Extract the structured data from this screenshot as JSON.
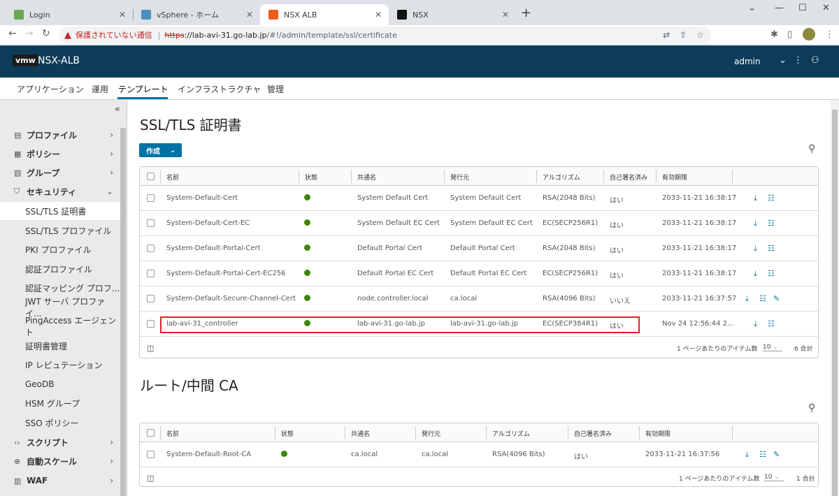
{
  "browser": {
    "tabs": [
      {
        "label": "Login",
        "active": false
      },
      {
        "label": "vSphere - ホーム",
        "active": false
      },
      {
        "label": "NSX ALB",
        "active": true
      },
      {
        "label": "NSX",
        "active": false
      }
    ],
    "address": {
      "insecure_label": "保護されていない通信",
      "scheme": "https",
      "host": "://lab-avi-31.go-lab.jp",
      "path": "/#!/admin/template/ssl/certificate"
    }
  },
  "app": {
    "logo": "vmw",
    "title": "NSX-ALB",
    "user": "admin"
  },
  "mainnav": [
    "アプリケーション",
    "運用",
    "テンプレート",
    "インフラストラクチャ",
    "管理"
  ],
  "sidebar": {
    "items": [
      {
        "label": "プロファイル",
        "type": "group"
      },
      {
        "label": "ポリシー",
        "type": "group"
      },
      {
        "label": "グループ",
        "type": "group"
      },
      {
        "label": "セキュリティ",
        "type": "group"
      },
      {
        "label": "SSL/TLS 証明書",
        "type": "sub"
      },
      {
        "label": "SSL/TLS プロファイル",
        "type": "sub"
      },
      {
        "label": "PKI プロファイル",
        "type": "sub"
      },
      {
        "label": "認証プロファイル",
        "type": "sub"
      },
      {
        "label": "認証マッピング プロフ...",
        "type": "sub"
      },
      {
        "label": "JWT サーバ プロファイ...",
        "type": "sub"
      },
      {
        "label": "PingAccess エージェント",
        "type": "sub"
      },
      {
        "label": "証明書管理",
        "type": "sub"
      },
      {
        "label": "IP レピュテーション",
        "type": "sub"
      },
      {
        "label": "GeoDB",
        "type": "sub"
      },
      {
        "label": "HSM グループ",
        "type": "sub"
      },
      {
        "label": "SSO ポリシー",
        "type": "sub"
      },
      {
        "label": "スクリプト",
        "type": "group"
      },
      {
        "label": "自動スケール",
        "type": "group"
      },
      {
        "label": "WAF",
        "type": "group"
      }
    ]
  },
  "certs": {
    "title": "SSL/TLS 証明書",
    "create_label": "作成",
    "columns": [
      "名前",
      "状態",
      "共通名",
      "発行元",
      "アルゴリズム",
      "自己署名済み",
      "有効期限"
    ],
    "rows": [
      [
        "System-Default-Cert",
        "System Default Cert",
        "System Default Cert",
        "RSA(2048 Bits)",
        "はい",
        "2033-11-21 16:38:17"
      ],
      [
        "System-Default-Cert-EC",
        "System Default EC Cert",
        "System Default EC Cert",
        "EC(SECP256R1)",
        "はい",
        "2033-11-21 16:38:17"
      ],
      [
        "System-Default-Portal-Cert",
        "Default Portal Cert",
        "Default Portal Cert",
        "RSA(2048 Bits)",
        "はい",
        "2033-11-21 16:38:17"
      ],
      [
        "System-Default-Portal-Cert-EC256",
        "Default Portal EC Cert",
        "Default Portal EC Cert",
        "EC(SECP256R1)",
        "はい",
        "2033-11-21 16:38:17"
      ],
      [
        "System-Default-Secure-Channel-Cert",
        "node.controller.local",
        "ca.local",
        "RSA(4096 Bits)",
        "いいえ",
        "2033-11-21 16:37:57"
      ],
      [
        "lab-avi-31_controller",
        "lab-avi-31.go-lab.jp",
        "lab-avi-31.go-lab.jp",
        "EC(SECP384R1)",
        "はい",
        "Nov 24 12:56:44 2..."
      ]
    ],
    "footer": {
      "per_page_label": "1 ページあたりのアイテム数",
      "per_page": "10",
      "total": "6 合計"
    }
  },
  "ca": {
    "title": "ルート/中間 CA",
    "columns": [
      "名前",
      "状態",
      "共通名",
      "発行元",
      "アルゴリズム",
      "自己署名済み",
      "有効期限"
    ],
    "rows": [
      [
        "System-Default-Root-CA",
        "ca.local",
        "ca.local",
        "RSA(4096 Bits)",
        "はい",
        "2033-11-21 16:37:56"
      ]
    ],
    "footer": {
      "per_page_label": "1 ページあたりのアイテム数",
      "per_page": "10",
      "total": "1 合計"
    }
  },
  "colors": {
    "appbar": "#0d3c5a",
    "accent": "#0072a3",
    "ok": "#3c8500",
    "highlight": "#e0202a"
  }
}
